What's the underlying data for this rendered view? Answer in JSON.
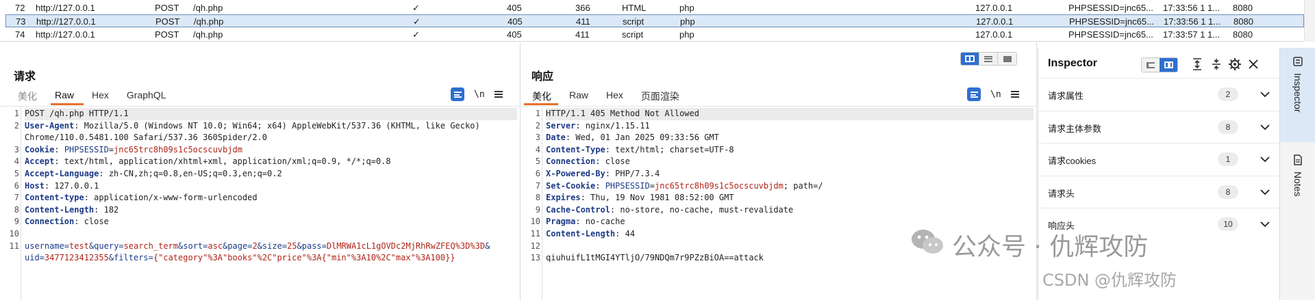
{
  "history": {
    "rows": [
      {
        "num": "72",
        "host": "http://127.0.0.1",
        "method": "POST",
        "url": "/qh.php",
        "params": "✓",
        "status": "405",
        "length": "366",
        "mime": "HTML",
        "ext": "php",
        "ip": "127.0.0.1",
        "cookies": "PHPSESSID=jnc65...",
        "time": "17:33:56 1 1...",
        "port": "8080",
        "selected": false
      },
      {
        "num": "73",
        "host": "http://127.0.0.1",
        "method": "POST",
        "url": "/qh.php",
        "params": "✓",
        "status": "405",
        "length": "411",
        "mime": "script",
        "ext": "php",
        "ip": "127.0.0.1",
        "cookies": "PHPSESSID=jnc65...",
        "time": "17:33:56 1 1...",
        "port": "8080",
        "selected": true
      },
      {
        "num": "74",
        "host": "http://127.0.0.1",
        "method": "POST",
        "url": "/qh.php",
        "params": "✓",
        "status": "405",
        "length": "411",
        "mime": "script",
        "ext": "php",
        "ip": "127.0.0.1",
        "cookies": "PHPSESSID=jnc65...",
        "time": "17:33:57 1 1...",
        "port": "8080",
        "selected": false
      }
    ]
  },
  "request": {
    "title": "请求",
    "tabs": [
      {
        "label": "美化",
        "state": "muted"
      },
      {
        "label": "Raw",
        "state": "active"
      },
      {
        "label": "Hex",
        "state": "normal"
      },
      {
        "label": "GraphQL",
        "state": "normal"
      }
    ],
    "wrap_label": "\\n",
    "line_numbers": [
      "1",
      "2",
      "",
      "3",
      "4",
      "5",
      "6",
      "7",
      "8",
      "9",
      "10",
      "11",
      ""
    ],
    "lines": [
      {
        "parts": [
          {
            "t": "POST /qh.php HTTP/1.1",
            "c": ""
          }
        ]
      },
      {
        "parts": [
          {
            "t": "User-Agent",
            "c": "hk"
          },
          {
            "t": ": Mozilla/5.0 (Windows NT 10.0; Win64; x64) AppleWebKit/537.36 (KHTML, like Gecko)",
            "c": ""
          }
        ]
      },
      {
        "parts": [
          {
            "t": "Chrome/110.0.5481.100 Safari/537.36 360Spider/2.0",
            "c": ""
          }
        ]
      },
      {
        "parts": [
          {
            "t": "Cookie",
            "c": "hk"
          },
          {
            "t": ": ",
            "c": ""
          },
          {
            "t": "PHPSESSID",
            "c": "pk"
          },
          {
            "t": "=",
            "c": ""
          },
          {
            "t": "jnc65trc8h09s1c5ocscuvbjdm",
            "c": "pv"
          }
        ]
      },
      {
        "parts": [
          {
            "t": "Accept",
            "c": "hk"
          },
          {
            "t": ": text/html, application/xhtml+xml, application/xml;q=0.9, */*;q=0.8",
            "c": ""
          }
        ]
      },
      {
        "parts": [
          {
            "t": "Accept-Language",
            "c": "hk"
          },
          {
            "t": ": zh-CN,zh;q=0.8,en-US;q=0.3,en;q=0.2",
            "c": ""
          }
        ]
      },
      {
        "parts": [
          {
            "t": "Host",
            "c": "hk"
          },
          {
            "t": ": 127.0.0.1",
            "c": ""
          }
        ]
      },
      {
        "parts": [
          {
            "t": "Content-type",
            "c": "hk"
          },
          {
            "t": ": application/x-www-form-urlencoded",
            "c": ""
          }
        ]
      },
      {
        "parts": [
          {
            "t": "Content-Length",
            "c": "hk"
          },
          {
            "t": ": 182",
            "c": ""
          }
        ]
      },
      {
        "parts": [
          {
            "t": "Connection",
            "c": "hk"
          },
          {
            "t": ": close",
            "c": ""
          }
        ]
      },
      {
        "parts": [
          {
            "t": "",
            "c": ""
          }
        ]
      },
      {
        "parts": [
          {
            "t": "username",
            "c": "pk"
          },
          {
            "t": "=",
            "c": "op"
          },
          {
            "t": "test",
            "c": "pv"
          },
          {
            "t": "&",
            "c": "op"
          },
          {
            "t": "query",
            "c": "pk"
          },
          {
            "t": "=",
            "c": "op"
          },
          {
            "t": "search_term",
            "c": "pv"
          },
          {
            "t": "&",
            "c": "op"
          },
          {
            "t": "sort",
            "c": "pk"
          },
          {
            "t": "=",
            "c": "op"
          },
          {
            "t": "asc",
            "c": "pv"
          },
          {
            "t": "&",
            "c": "op"
          },
          {
            "t": "page",
            "c": "pk"
          },
          {
            "t": "=",
            "c": "op"
          },
          {
            "t": "2",
            "c": "pv"
          },
          {
            "t": "&",
            "c": "op"
          },
          {
            "t": "size",
            "c": "pk"
          },
          {
            "t": "=",
            "c": "op"
          },
          {
            "t": "25",
            "c": "pv"
          },
          {
            "t": "&",
            "c": "op"
          },
          {
            "t": "pass",
            "c": "pk"
          },
          {
            "t": "=",
            "c": "op"
          },
          {
            "t": "DlMRWA1cL1gOVDc2MjRhRwZFEQ%3D%3D",
            "c": "pv"
          },
          {
            "t": "&",
            "c": "op"
          }
        ]
      },
      {
        "parts": [
          {
            "t": "uid",
            "c": "pk"
          },
          {
            "t": "=",
            "c": "op"
          },
          {
            "t": "3477123412355",
            "c": "pv"
          },
          {
            "t": "&",
            "c": "op"
          },
          {
            "t": "filters",
            "c": "pk"
          },
          {
            "t": "=",
            "c": "op"
          },
          {
            "t": "{\"category\"%3A\"books\"%2C\"price\"%3A{\"min\"%3A10%2C\"max\"%3A100}}",
            "c": "pv"
          }
        ]
      }
    ]
  },
  "response": {
    "title": "响应",
    "tabs": [
      {
        "label": "美化",
        "state": "active"
      },
      {
        "label": "Raw",
        "state": "normal"
      },
      {
        "label": "Hex",
        "state": "normal"
      },
      {
        "label": "页面渲染",
        "state": "normal"
      }
    ],
    "wrap_label": "\\n",
    "line_numbers": [
      "1",
      "2",
      "3",
      "4",
      "5",
      "6",
      "7",
      "8",
      "9",
      "10",
      "11",
      "12",
      "13"
    ],
    "lines": [
      {
        "parts": [
          {
            "t": "HTTP/1.1 405 Method Not Allowed",
            "c": ""
          }
        ]
      },
      {
        "parts": [
          {
            "t": "Server",
            "c": "hk"
          },
          {
            "t": ": nginx/1.15.11",
            "c": ""
          }
        ]
      },
      {
        "parts": [
          {
            "t": "Date",
            "c": "hk"
          },
          {
            "t": ": Wed, 01 Jan 2025 09:33:56 GMT",
            "c": ""
          }
        ]
      },
      {
        "parts": [
          {
            "t": "Content-Type",
            "c": "hk"
          },
          {
            "t": ": text/html; charset=UTF-8",
            "c": ""
          }
        ]
      },
      {
        "parts": [
          {
            "t": "Connection",
            "c": "hk"
          },
          {
            "t": ": close",
            "c": ""
          }
        ]
      },
      {
        "parts": [
          {
            "t": "X-Powered-By",
            "c": "hk"
          },
          {
            "t": ": PHP/7.3.4",
            "c": ""
          }
        ]
      },
      {
        "parts": [
          {
            "t": "Set-Cookie",
            "c": "hk"
          },
          {
            "t": ": ",
            "c": ""
          },
          {
            "t": "PHPSESSID",
            "c": "pk"
          },
          {
            "t": "=",
            "c": ""
          },
          {
            "t": "jnc65trc8h09s1c5ocscuvbjdm",
            "c": "pv"
          },
          {
            "t": "; path=/",
            "c": ""
          }
        ]
      },
      {
        "parts": [
          {
            "t": "Expires",
            "c": "hk"
          },
          {
            "t": ": Thu, 19 Nov 1981 08:52:00 GMT",
            "c": ""
          }
        ]
      },
      {
        "parts": [
          {
            "t": "Cache-Control",
            "c": "hk"
          },
          {
            "t": ": no-store, no-cache, must-revalidate",
            "c": ""
          }
        ]
      },
      {
        "parts": [
          {
            "t": "Pragma",
            "c": "hk"
          },
          {
            "t": ": no-cache",
            "c": ""
          }
        ]
      },
      {
        "parts": [
          {
            "t": "Content-Length",
            "c": "hk"
          },
          {
            "t": ": 44",
            "c": ""
          }
        ]
      },
      {
        "parts": [
          {
            "t": "",
            "c": ""
          }
        ]
      },
      {
        "parts": [
          {
            "t": "qiuhuifL1tMGI4YTljO/79NDQm7r9PZzBiOA==attack",
            "c": ""
          }
        ]
      }
    ]
  },
  "inspector": {
    "title": "Inspector",
    "sections": [
      {
        "label": "请求属性",
        "count": "2"
      },
      {
        "label": "请求主体参数",
        "count": "8"
      },
      {
        "label": "请求cookies",
        "count": "1"
      },
      {
        "label": "请求头",
        "count": "8"
      },
      {
        "label": "响应头",
        "count": "10"
      }
    ]
  },
  "side_tabs": [
    {
      "label": "Inspector",
      "active": true
    },
    {
      "label": "Notes",
      "active": false
    }
  ],
  "watermark": {
    "line1": "公众号 · 仇辉攻防",
    "line2": "CSDN @仇辉攻防"
  },
  "colors": {
    "accent_blue": "#2e6fd0",
    "tab_underline": "#e8702a",
    "header_key": "#1c3a86",
    "param_value": "#b02418",
    "selected_row": "#dbe8f7"
  }
}
